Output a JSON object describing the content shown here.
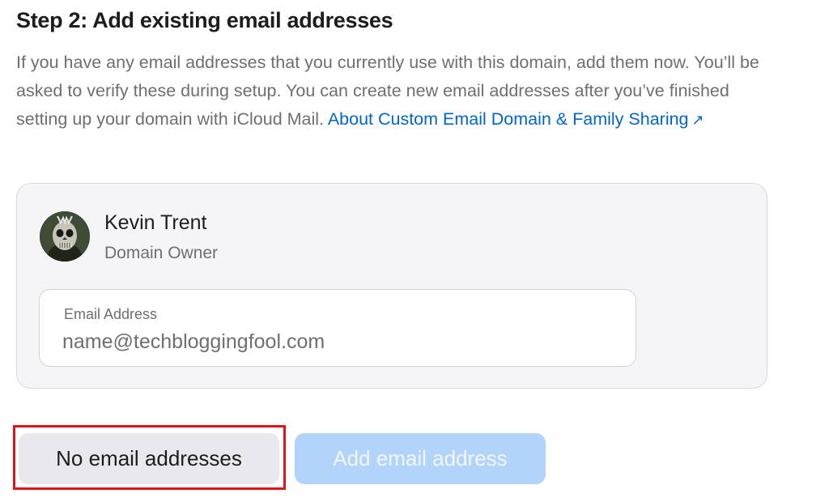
{
  "step": {
    "title": "Step 2: Add existing email addresses",
    "description": "If you have any email addresses that you currently use with this domain, add them now. You’ll be asked to verify these during setup. You can create new email addresses after you’ve finished setting up your domain with iCloud Mail. ",
    "link_text": "About Custom Email Domain & Family Sharing",
    "link_icon": "external-arrow-icon",
    "link_icon_glyph": "↗"
  },
  "member": {
    "name": "Kevin Trent",
    "role": "Domain Owner",
    "avatar_icon": "game-character-avatar"
  },
  "email_field": {
    "label": "Email Address",
    "placeholder": "name@techbloggingfool.com",
    "value": ""
  },
  "buttons": {
    "no_email_label": "No email addresses",
    "add_email_label": "Add email address",
    "add_email_disabled": true
  },
  "colors": {
    "link": "#0066cc",
    "highlight": "#e0141e",
    "primary_disabled": "#b3d4fa"
  }
}
